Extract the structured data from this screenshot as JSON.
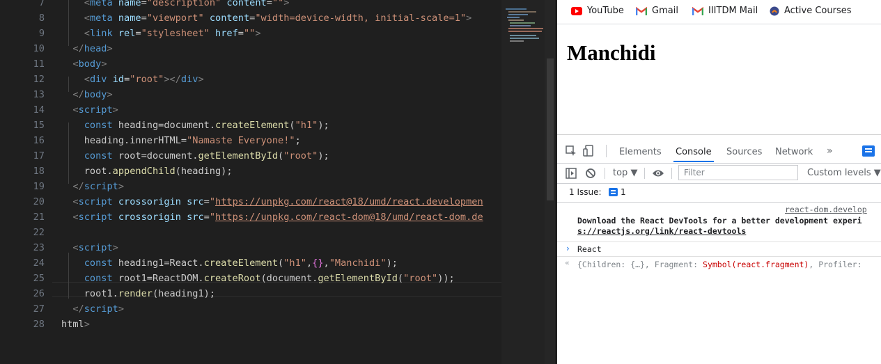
{
  "editor": {
    "lines": [
      {
        "n": "7",
        "segs": [
          [
            "tag-ang",
            "<"
          ],
          [
            "tag",
            "meta"
          ],
          [
            "pl",
            " "
          ],
          [
            "attr",
            "name"
          ],
          [
            "pl",
            "="
          ],
          [
            "str",
            "\"description\""
          ],
          [
            "pl",
            " "
          ],
          [
            "attr",
            "content"
          ],
          [
            "pl",
            "="
          ],
          [
            "str",
            "\"\""
          ],
          [
            "tag-ang",
            ">"
          ]
        ]
      },
      {
        "n": "8",
        "segs": [
          [
            "tag-ang",
            "<"
          ],
          [
            "tag",
            "meta"
          ],
          [
            "pl",
            " "
          ],
          [
            "attr",
            "name"
          ],
          [
            "pl",
            "="
          ],
          [
            "str",
            "\"viewport\""
          ],
          [
            "pl",
            " "
          ],
          [
            "attr",
            "content"
          ],
          [
            "pl",
            "="
          ],
          [
            "str",
            "\"width=device-width, initial-scale=1\""
          ],
          [
            "tag-ang",
            ">"
          ]
        ]
      },
      {
        "n": "9",
        "segs": [
          [
            "tag-ang",
            "<"
          ],
          [
            "tag",
            "link"
          ],
          [
            "pl",
            " "
          ],
          [
            "attr",
            "rel"
          ],
          [
            "pl",
            "="
          ],
          [
            "str",
            "\"stylesheet\""
          ],
          [
            "pl",
            " "
          ],
          [
            "attr",
            "href"
          ],
          [
            "pl",
            "="
          ],
          [
            "str",
            "\"\""
          ],
          [
            "tag-ang",
            ">"
          ]
        ]
      },
      {
        "n": "10",
        "segs": [
          [
            "tag-ang",
            "</"
          ],
          [
            "tag",
            "head"
          ],
          [
            "tag-ang",
            ">"
          ]
        ]
      },
      {
        "n": "11",
        "segs": [
          [
            "tag-ang",
            "<"
          ],
          [
            "tag",
            "body"
          ],
          [
            "tag-ang",
            ">"
          ]
        ]
      },
      {
        "n": "12",
        "segs": [
          [
            "tag-ang",
            "<"
          ],
          [
            "tag",
            "div"
          ],
          [
            "pl",
            " "
          ],
          [
            "attr",
            "id"
          ],
          [
            "pl",
            "="
          ],
          [
            "str",
            "\"root\""
          ],
          [
            "tag-ang",
            "></"
          ],
          [
            "tag",
            "div"
          ],
          [
            "tag-ang",
            ">"
          ]
        ]
      },
      {
        "n": "13",
        "segs": [
          [
            "tag-ang",
            "</"
          ],
          [
            "tag",
            "body"
          ],
          [
            "tag-ang",
            ">"
          ]
        ]
      },
      {
        "n": "14",
        "segs": [
          [
            "tag-ang",
            "<"
          ],
          [
            "tag",
            "script"
          ],
          [
            "tag-ang",
            ">"
          ]
        ]
      },
      {
        "n": "15",
        "segs": [
          [
            "tag",
            "const"
          ],
          [
            "pl",
            " heading=document."
          ],
          [
            "fn",
            "createElement"
          ],
          [
            "pl",
            "("
          ],
          [
            "str",
            "\"h1\""
          ],
          [
            "pl",
            ");"
          ]
        ]
      },
      {
        "n": "16",
        "segs": [
          [
            "pl",
            "heading.innerHTML="
          ],
          [
            "str",
            "\"Namaste Everyone!\""
          ],
          [
            "pl",
            ";"
          ]
        ]
      },
      {
        "n": "17",
        "segs": [
          [
            "tag",
            "const"
          ],
          [
            "pl",
            " root=document."
          ],
          [
            "fn",
            "getElementById"
          ],
          [
            "pl",
            "("
          ],
          [
            "str",
            "\"root\""
          ],
          [
            "pl",
            ");"
          ]
        ]
      },
      {
        "n": "18",
        "segs": [
          [
            "pl",
            "root."
          ],
          [
            "fn",
            "appendChild"
          ],
          [
            "pl",
            "(heading);"
          ]
        ]
      },
      {
        "n": "19",
        "segs": [
          [
            "tag-ang",
            "</"
          ],
          [
            "tag",
            "script"
          ],
          [
            "tag-ang",
            ">"
          ]
        ]
      },
      {
        "n": "20",
        "segs": [
          [
            "tag-ang",
            "<"
          ],
          [
            "tag",
            "script"
          ],
          [
            "pl",
            " "
          ],
          [
            "attr",
            "crossorigin"
          ],
          [
            "pl",
            " "
          ],
          [
            "attr",
            "src"
          ],
          [
            "pl",
            "="
          ],
          [
            "str",
            "\""
          ],
          [
            "url",
            "https://unpkg.com/react@18/umd/react.developmen"
          ]
        ]
      },
      {
        "n": "21",
        "segs": [
          [
            "tag-ang",
            "<"
          ],
          [
            "tag",
            "script"
          ],
          [
            "pl",
            " "
          ],
          [
            "attr",
            "crossorigin"
          ],
          [
            "pl",
            " "
          ],
          [
            "attr",
            "src"
          ],
          [
            "pl",
            "="
          ],
          [
            "str",
            "\""
          ],
          [
            "url",
            "https://unpkg.com/react-dom@18/umd/react-dom.de"
          ]
        ]
      },
      {
        "n": "22",
        "segs": []
      },
      {
        "n": "23",
        "segs": [
          [
            "tag-ang",
            "<"
          ],
          [
            "tag",
            "script"
          ],
          [
            "tag-ang",
            ">"
          ]
        ]
      },
      {
        "n": "24",
        "segs": [
          [
            "tag",
            "const"
          ],
          [
            "pl",
            " heading1=React."
          ],
          [
            "fn",
            "createElement"
          ],
          [
            "pl",
            "("
          ],
          [
            "str",
            "\"h1\""
          ],
          [
            "pl",
            ","
          ],
          [
            "br",
            "{}"
          ],
          [
            "pl",
            ","
          ],
          [
            "str",
            "\"Manchidi\""
          ],
          [
            "pl",
            ");"
          ]
        ]
      },
      {
        "n": "25",
        "segs": [
          [
            "tag",
            "const"
          ],
          [
            "pl",
            " root1=ReactDOM."
          ],
          [
            "fn",
            "createRoot"
          ],
          [
            "pl",
            "(document."
          ],
          [
            "fn",
            "getElementById"
          ],
          [
            "pl",
            "("
          ],
          [
            "str",
            "\"root\""
          ],
          [
            "pl",
            "));"
          ]
        ]
      },
      {
        "n": "26",
        "segs": [
          [
            "pl",
            "root1."
          ],
          [
            "fn",
            "render"
          ],
          [
            "pl",
            "(heading1);"
          ]
        ]
      },
      {
        "n": "27",
        "segs": [
          [
            "tag-ang",
            "</"
          ],
          [
            "tag",
            "script"
          ],
          [
            "tag-ang",
            ">"
          ]
        ]
      },
      {
        "n": "28",
        "segs": [
          [
            "pl",
            "html"
          ],
          [
            "tag-ang",
            ">"
          ]
        ]
      }
    ]
  },
  "browser": {
    "bookmarks": [
      {
        "label": "YouTube",
        "icon": "youtube-icon",
        "color": "#ff0000"
      },
      {
        "label": "Gmail",
        "icon": "gmail-icon",
        "color": "#ea4335"
      },
      {
        "label": "IIITDM Mail",
        "icon": "gmail-icon",
        "color": "#ea4335"
      },
      {
        "label": "Active Courses",
        "icon": "moodle-icon",
        "color": "#f98012"
      }
    ],
    "page_heading": "Manchidi"
  },
  "devtools": {
    "tabs": [
      {
        "label": "Elements",
        "active": false
      },
      {
        "label": "Console",
        "active": true
      },
      {
        "label": "Sources",
        "active": false
      },
      {
        "label": "Network",
        "active": false
      }
    ],
    "more_tabs": "»",
    "context": "top",
    "filter_placeholder": "Filter",
    "levels": "Custom levels ▼",
    "issues_label": "1 Issue:",
    "issues_count": "1",
    "messages": {
      "source_link": "react-dom.develop",
      "devtools_line1": "Download the React DevTools for a better development experi",
      "devtools_link": "s://reactjs.org/link/react-devtools",
      "input_echo": "React",
      "result_prefix": "{Children: {…}, Fragment: ",
      "result_symbol": "Symbol(react.fragment)",
      "result_suffix": ", Profiler:"
    },
    "accent": "#1a73e8"
  }
}
